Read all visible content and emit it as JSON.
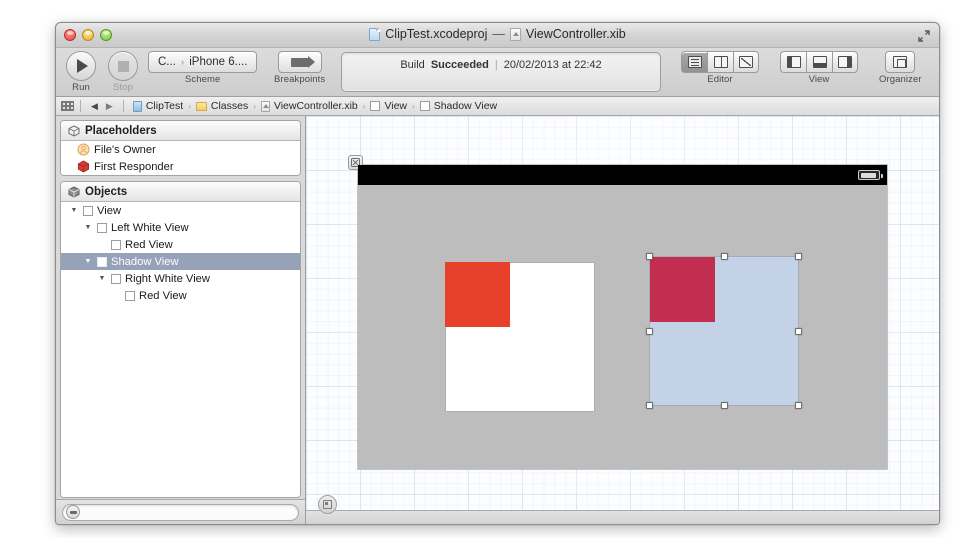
{
  "window": {
    "title_project": "ClipTest.xcodeproj",
    "title_dash": "—",
    "title_file": "ViewController.xib"
  },
  "toolbar": {
    "run_label": "Run",
    "stop_label": "Stop",
    "scheme_label": "Scheme",
    "scheme_project": "C...",
    "scheme_separator": "›",
    "scheme_destination": "iPhone 6....",
    "breakpoints_label": "Breakpoints",
    "editor_label": "Editor",
    "view_label": "View",
    "organizer_label": "Organizer"
  },
  "status": {
    "build_prefix": "Build",
    "build_result": "Succeeded",
    "separator": "|",
    "timestamp": "20/02/2013 at 22:42"
  },
  "jumpbar": {
    "crumbs": [
      {
        "label": "ClipTest",
        "icon": "project-icon"
      },
      {
        "label": "Classes",
        "icon": "folder-icon"
      },
      {
        "label": "ViewController.xib",
        "icon": "xib-icon"
      },
      {
        "label": "View",
        "icon": "view-icon"
      },
      {
        "label": "Shadow View",
        "icon": "view-icon"
      }
    ],
    "chevron": "›"
  },
  "outline": {
    "placeholders_header": "Placeholders",
    "placeholders": [
      {
        "label": "File's Owner",
        "icon": "files-owner-icon"
      },
      {
        "label": "First Responder",
        "icon": "first-responder-icon"
      }
    ],
    "objects_header": "Objects",
    "objects": [
      {
        "label": "View",
        "depth": 0,
        "expanded": true,
        "selected": false
      },
      {
        "label": "Left White View",
        "depth": 1,
        "expanded": true,
        "selected": false
      },
      {
        "label": "Red View",
        "depth": 2,
        "expanded": false,
        "selected": false
      },
      {
        "label": "Shadow View",
        "depth": 1,
        "expanded": true,
        "selected": true
      },
      {
        "label": "Right White View",
        "depth": 2,
        "expanded": true,
        "selected": false
      },
      {
        "label": "Red View",
        "depth": 3,
        "expanded": false,
        "selected": false
      }
    ],
    "filter_placeholder": ""
  },
  "canvas": {
    "left_white_view_color": "#ffffff",
    "left_red_view_color": "#e8412b",
    "shadow_view_color": "#c4d2e8",
    "right_red_view_color": "#c22e4f",
    "device_background": "#bdbdbd",
    "status_bar_color": "#000000",
    "selection_handle_color": "#ffffff",
    "selected_object": "Shadow View"
  },
  "colors": {
    "selection_row": "#96a2b7",
    "window_chrome": "#d8d8d8",
    "canvas_grid": "#a8c4e0"
  }
}
